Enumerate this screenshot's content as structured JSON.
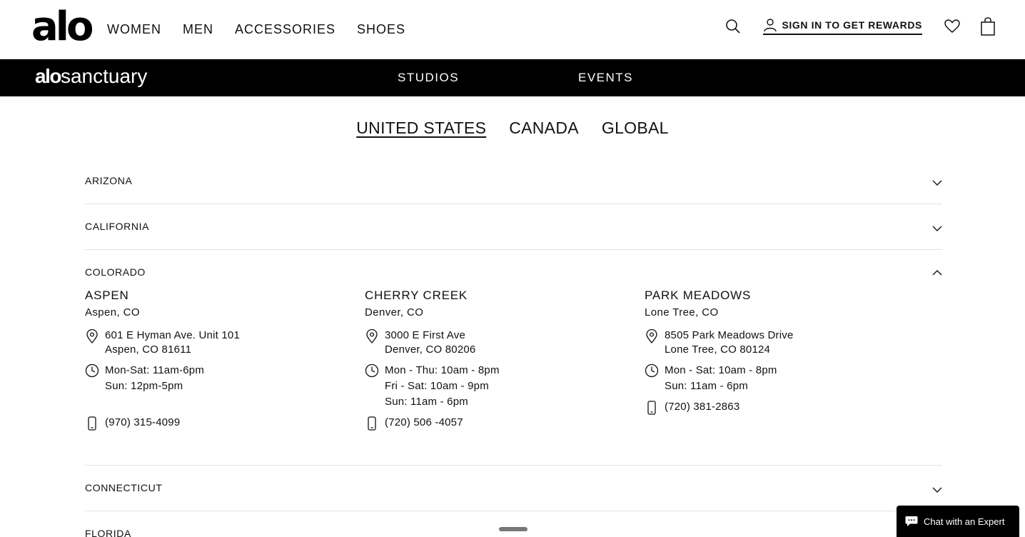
{
  "header": {
    "logo": "alo",
    "nav": [
      "WOMEN",
      "MEN",
      "ACCESSORIES",
      "SHOES"
    ],
    "signin_label": "SIGN IN TO GET REWARDS"
  },
  "sanctuary": {
    "logo_bold": "alo",
    "logo_light": "sanctuary",
    "nav": [
      "STUDIOS",
      "EVENTS"
    ]
  },
  "tabs": [
    "UNITED STATES",
    "CANADA",
    "GLOBAL"
  ],
  "states": {
    "arizona": "ARIZONA",
    "california": "CALIFORNIA",
    "colorado": "COLORADO",
    "connecticut": "CONNECTICUT",
    "florida": "FLORIDA"
  },
  "stores": [
    {
      "name": "ASPEN",
      "city": "Aspen, CO",
      "address": [
        "601 E Hyman Ave. Unit 101",
        "Aspen, CO 81611"
      ],
      "hours": [
        "Mon-Sat: 11am-6pm",
        "Sun: 12pm-5pm"
      ],
      "phone": "(970) 315-4099"
    },
    {
      "name": "CHERRY CREEK",
      "city": "Denver, CO",
      "address": [
        "3000 E First Ave",
        "Denver, CO 80206"
      ],
      "hours": [
        "Mon - Thu: 10am - 8pm",
        "Fri - Sat: 10am - 9pm",
        "Sun: 11am - 6pm"
      ],
      "phone": "(720) 506 -4057"
    },
    {
      "name": "PARK MEADOWS",
      "city": "Lone Tree, CO",
      "address": [
        "8505 Park Meadows Drive",
        "Lone Tree, CO 80124"
      ],
      "hours": [
        "Mon - Sat: 10am - 8pm",
        "Sun: 11am - 6pm"
      ],
      "phone": "(720) 381-2863"
    }
  ],
  "chat": {
    "label": "Chat with an Expert"
  }
}
